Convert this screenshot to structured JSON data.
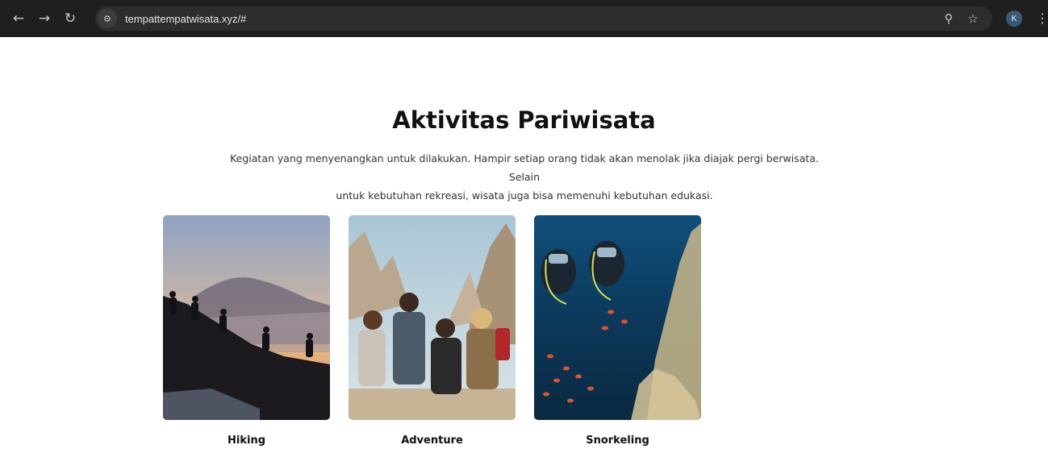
{
  "browser": {
    "url": "tempattempatwisata.xyz/#",
    "profile_initial": "K",
    "icons": {
      "back": "arrow-left-icon",
      "forward": "arrow-right-icon",
      "reload": "reload-icon",
      "site_info": "tune-icon",
      "zoom": "zoom-icon",
      "bookmark": "star-icon",
      "menu": "kebab-menu-icon"
    }
  },
  "section": {
    "title": "Aktivitas Pariwisata",
    "description_line1": "Kegiatan yang menyenangkan untuk dilakukan. Hampir setiap orang tidak akan menolak jika diajak pergi berwisata. Selain",
    "description_line2": "untuk kebutuhan rekreasi, wisata juga bisa memenuhi kebutuhan edukasi."
  },
  "cards": [
    {
      "label": "Hiking"
    },
    {
      "label": "Adventure"
    },
    {
      "label": "Snorkeling"
    }
  ],
  "colors": {
    "chrome_bg": "#1f1f1f",
    "omnibox_bg": "#2d2d2d",
    "title_text": "#111111",
    "body_text": "#333333"
  }
}
